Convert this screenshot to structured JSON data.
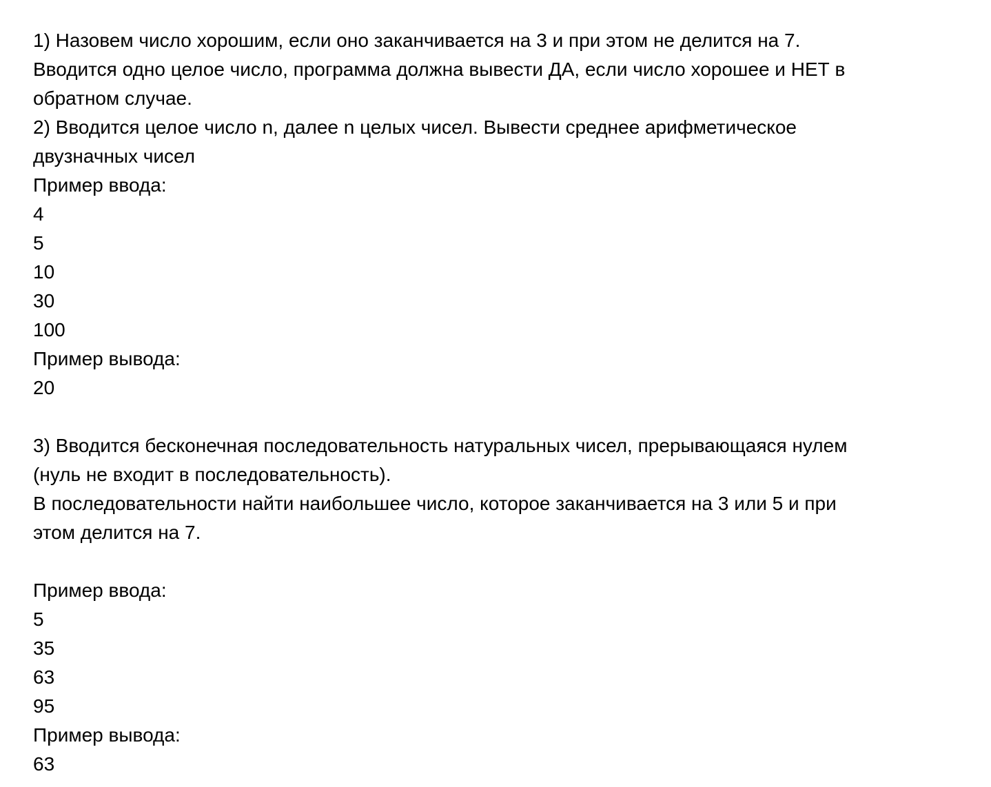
{
  "lines": [
    "1) Назовем число хорошим, если оно заканчивается на 3 и при этом не делится на 7.",
    "Вводится одно целое число, программа должна вывести ДА, если число хорошее и НЕТ в",
    "обратном случае.",
    "2) Вводится целое число n, далее n целых чисел. Вывести среднее арифметическое",
    "двузначных чисел",
    "Пример ввода:",
    "4",
    "5",
    "10",
    "30",
    "100",
    "Пример вывода:",
    "20",
    "",
    "3) Вводится бесконечная последовательность натуральных чисел, прерывающаяся нулем",
    "(нуль не входит в последовательность).",
    "В последовательности найти наибольшее число, которое заканчивается на 3 или 5 и при",
    "этом делится на 7.",
    "",
    "Пример ввода:",
    "5",
    "35",
    "63",
    "95",
    "Пример вывода:",
    "63"
  ]
}
